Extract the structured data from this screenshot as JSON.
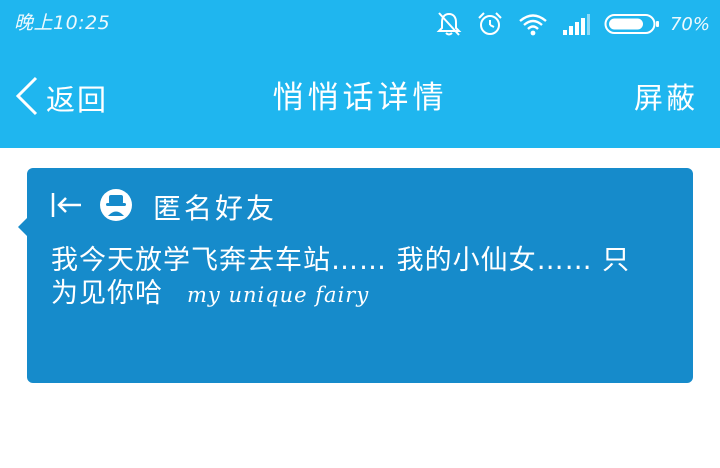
{
  "status_bar": {
    "time": "晚上10:25",
    "battery_percent": "70%",
    "icons": [
      "bell-off-icon",
      "alarm-clock-icon",
      "wifi-icon",
      "signal-icon",
      "battery-icon"
    ]
  },
  "header": {
    "back_label": "返回",
    "title": "悄悄话详情",
    "block_label": "屏蔽"
  },
  "message": {
    "sender": "匿名好友",
    "text": "我今天放学飞奔去车站…… 我的小仙女…… 只为见你哈",
    "text_en": "my unique fairy"
  },
  "colors": {
    "accent": "#1fb6ef",
    "card": "#168bcb",
    "background": "#ffffff",
    "text_on_accent": "#ffffff"
  }
}
